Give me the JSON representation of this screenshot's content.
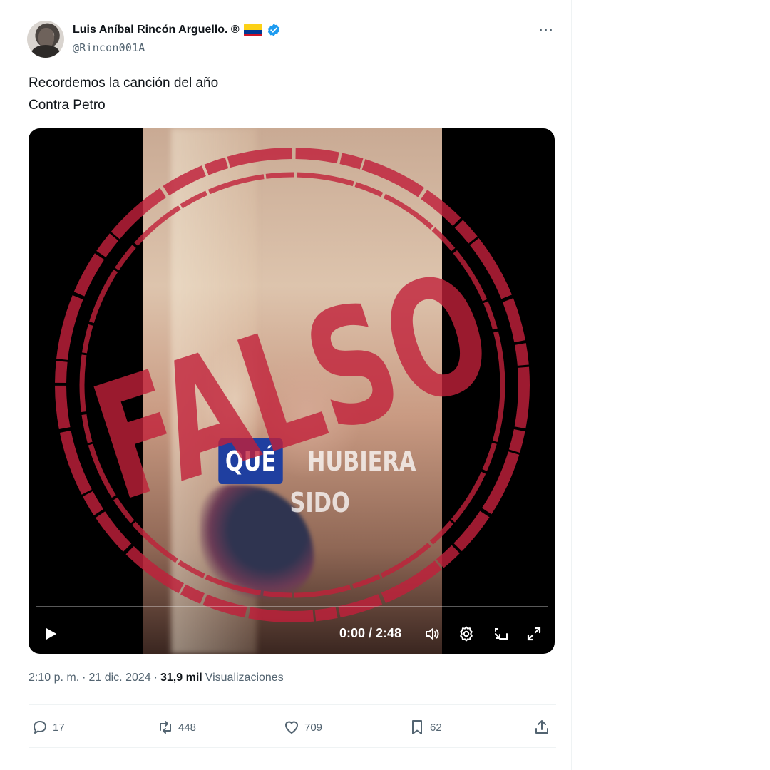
{
  "author": {
    "display_name": "Luis Aníbal Rincón Arguello. ®",
    "handle": "@Rincon001A"
  },
  "post": {
    "line1": "Recordemos la canción del año",
    "line2": "Contra Petro"
  },
  "video": {
    "watermark_box": "QUÉ",
    "watermark_text": "HUBIERA",
    "watermark_sub": "SIDO",
    "stamp_text": "FALSO",
    "time": "0:00 / 2:48",
    "progress": 0
  },
  "meta": {
    "time": "2:10 p. m.",
    "date": "21 dic. 2024",
    "views_count": "31,9 mil",
    "views_label": "Visualizaciones"
  },
  "actions": {
    "replies": "17",
    "reposts": "448",
    "likes": "709",
    "bookmarks": "62"
  },
  "colors": {
    "stamp_red": "#c0203a",
    "verified_blue": "#1d9bf0"
  }
}
